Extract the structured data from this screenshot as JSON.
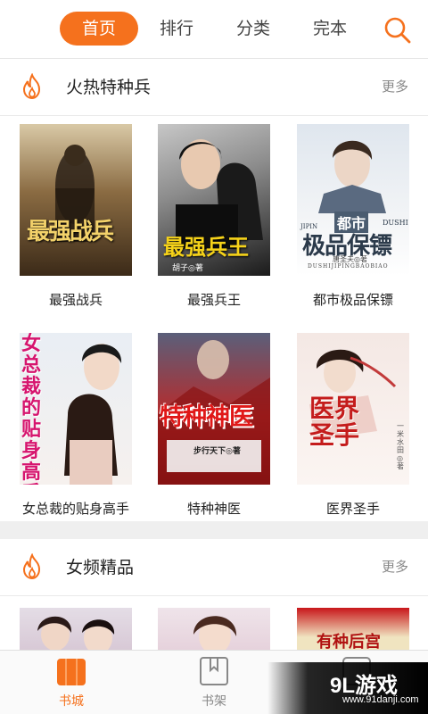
{
  "nav": {
    "tabs": [
      {
        "label": "首页",
        "active": true
      },
      {
        "label": "排行",
        "active": false
      },
      {
        "label": "分类",
        "active": false
      },
      {
        "label": "完本",
        "active": false
      }
    ],
    "search_icon": "search-icon"
  },
  "accent_color": "#f5711d",
  "sections": [
    {
      "title": "火热特种兵",
      "more": "更多",
      "icon": "fire-icon",
      "books": [
        {
          "title": "最强战兵",
          "cover_text": "最强战兵"
        },
        {
          "title": "最强兵王",
          "cover_text": "最强兵王",
          "author": "胡子◎著"
        },
        {
          "title": "都市极品保镖",
          "cover_text_top": "都市",
          "cover_text_main": "极品保镖",
          "cover_latin": "JIPIN",
          "cover_latin2": "DUSHI",
          "cover_sub": "DUSHIJIPINGBAOBIAO",
          "author": "唐圣夫◎著"
        },
        {
          "title": "女总裁的贴身高手",
          "cover_text": "女总裁的贴身高手"
        },
        {
          "title": "特种神医",
          "cover_text": "特种神医",
          "author": "步行天下◎著"
        },
        {
          "title": "医界圣手",
          "cover_text": "医界圣手",
          "author": "一米水田◎著"
        }
      ]
    },
    {
      "title": "女频精品",
      "more": "更多",
      "icon": "fire-icon",
      "books": [
        {
          "title": ""
        },
        {
          "title": ""
        },
        {
          "title": "",
          "cover_text": "有种后宫"
        }
      ]
    }
  ],
  "bottom_tabs": [
    {
      "label": "书城",
      "icon": "book-city-icon",
      "active": true
    },
    {
      "label": "书架",
      "icon": "bookshelf-icon",
      "active": false
    },
    {
      "label": "",
      "icon": "profile-icon",
      "active": false
    }
  ],
  "watermark": {
    "logo": "9L游戏",
    "url": "www.91danji.com"
  }
}
